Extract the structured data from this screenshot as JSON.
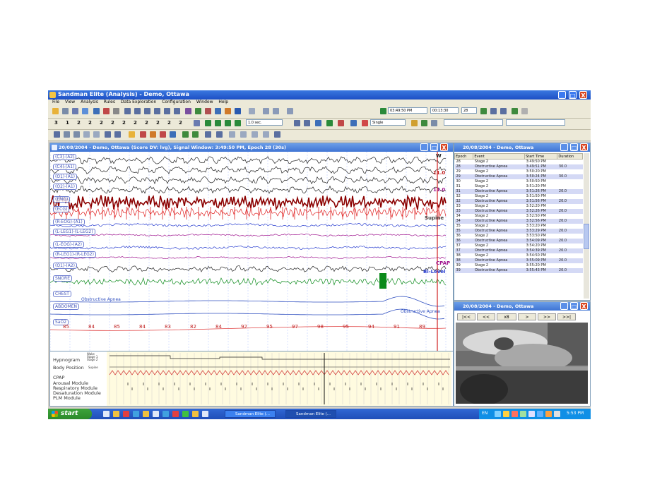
{
  "window": {
    "title": "Sandman Elite (Analysis) - Demo, Ottawa",
    "controls": {
      "minimize": "_",
      "maximize": "□",
      "close": "X"
    }
  },
  "menu": [
    "File",
    "View",
    "Analysis",
    "Rules",
    "Data Exploration",
    "Configuration",
    "Window",
    "Help"
  ],
  "toolbar": {
    "epoch_numbers": [
      "3",
      "1",
      "2",
      "2",
      "2",
      "2",
      "2",
      "2",
      "2",
      "2",
      "2",
      "2"
    ],
    "speed_select": "1.0 sec.",
    "time_start": "03:49:50 PM",
    "time_end": "00:13:30",
    "epoch_field": "28",
    "view_mode_select": "Single"
  },
  "signal_window": {
    "title": "20/08/2004 - Demo, Ottawa (Score DV: lvg), Signal Window: 3:49:50 PM, Epoch 28 (30s)",
    "channels": [
      "(C3)-(A2)",
      "(C4)-(A1)",
      "(O1)-(A1)",
      "(O2)-(A1)",
      "(EMG)",
      "(ECG)",
      "(R-EOG)-(A1)",
      "(L-LEG1)-(L-LEG2)",
      "(L-EOG)-(A2)",
      "(R-LEG1)-(R-LEG2)",
      "(O1)-(A2)",
      "SNORE",
      "CHEST",
      "ABDOMEN",
      "SaO2"
    ],
    "annotations": {
      "stage_code": "W",
      "pressure_1": "11.0",
      "pressure_2": "11.0",
      "position": "Supine",
      "therapy": "CPAP",
      "mode": "Bi-Level",
      "chest_event": "Obstructive Apnea",
      "abdomen_event": "Obstructive Apnea"
    },
    "spo2_values": [
      "85",
      "84",
      "85",
      "84",
      "83",
      "82",
      "84",
      "92",
      "95",
      "97",
      "98",
      "95",
      "94",
      "91",
      "89"
    ]
  },
  "hypnogram": {
    "labels": [
      "Hypnogram",
      "Body Position",
      "CPAP",
      "Arousal Module",
      "Respiratory Module",
      "Desaturation Module",
      "PLM Module"
    ],
    "stage_labels": [
      "Wake",
      "Stage 1",
      "Stage 2"
    ],
    "position_label": "Supine"
  },
  "event_list": {
    "title": "20/08/2004 - Demo, Ottawa",
    "columns": [
      "Epoch",
      "Event",
      "Start Time",
      "Duration"
    ],
    "rows": [
      [
        "28",
        "Stage 2",
        "3:49:50 PM",
        ""
      ],
      [
        "28",
        "Obstructive Apnea",
        "3:49:51 PM",
        "30.0"
      ],
      [
        "29",
        "Stage 2",
        "3:50:20 PM",
        ""
      ],
      [
        "29",
        "Obstructive Apnea",
        "3:50:24 PM",
        "30.0"
      ],
      [
        "30",
        "Stage 2",
        "3:50:50 PM",
        ""
      ],
      [
        "31",
        "Stage 2",
        "3:51:20 PM",
        ""
      ],
      [
        "31",
        "Obstructive Apnea",
        "3:51:26 PM",
        "20.0"
      ],
      [
        "32",
        "Stage 2",
        "3:51:50 PM",
        ""
      ],
      [
        "32",
        "Obstructive Apnea",
        "3:51:56 PM",
        "20.0"
      ],
      [
        "33",
        "Stage 2",
        "3:52:20 PM",
        ""
      ],
      [
        "33",
        "Obstructive Apnea",
        "3:52:26 PM",
        "20.0"
      ],
      [
        "34",
        "Stage 2",
        "3:52:50 PM",
        ""
      ],
      [
        "34",
        "Obstructive Apnea",
        "3:52:56 PM",
        "20.0"
      ],
      [
        "35",
        "Stage 2",
        "3:53:20 PM",
        ""
      ],
      [
        "35",
        "Obstructive Apnea",
        "3:53:29 PM",
        "20.0"
      ],
      [
        "36",
        "Stage 2",
        "3:53:50 PM",
        ""
      ],
      [
        "36",
        "Obstructive Apnea",
        "3:54:09 PM",
        "20.0"
      ],
      [
        "37",
        "Stage 2",
        "3:54:20 PM",
        ""
      ],
      [
        "37",
        "Obstructive Apnea",
        "3:54:39 PM",
        "20.0"
      ],
      [
        "38",
        "Stage 2",
        "3:54:50 PM",
        ""
      ],
      [
        "38",
        "Obstructive Apnea",
        "3:55:09 PM",
        "20.0"
      ],
      [
        "39",
        "Stage 2",
        "3:55:20 PM",
        ""
      ],
      [
        "39",
        "Obstructive Apnea",
        "3:55:43 PM",
        "20.0"
      ]
    ]
  },
  "video_window": {
    "title": "20/08/2004 - Demo, Ottawa",
    "controls": [
      "|<<",
      "<<",
      "x8",
      ">",
      ">>",
      ">>|"
    ]
  },
  "taskbar": {
    "start_label": "start",
    "tasks": [
      "Sandman Elite (...",
      "Sandman Elite (..."
    ],
    "lang": "EN",
    "clock": "5:53 PM"
  },
  "colors": {
    "eeg": "#222222",
    "emg": "#8b0000",
    "ecg": "#e02020",
    "eog": "#2a3fd0",
    "leg": "#a01890",
    "snore": "#0a8a1a",
    "resp": "#3050c0",
    "spo2_line": "#e04040",
    "event_highlight": "#d4d9f5"
  }
}
